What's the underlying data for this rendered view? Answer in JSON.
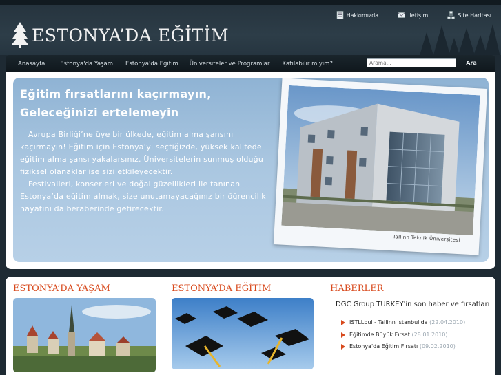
{
  "brand": {
    "title": "ESTONYA’DA EĞİTİM"
  },
  "toplinks": [
    {
      "label": "Hakkımızda",
      "icon": "document-icon"
    },
    {
      "label": "İletişim",
      "icon": "envelope-icon"
    },
    {
      "label": "Site Haritası",
      "icon": "sitemap-icon"
    }
  ],
  "nav": {
    "items": [
      {
        "label": "Anasayfa"
      },
      {
        "label": "Estonya'da Yaşam"
      },
      {
        "label": "Estonya'da Eğitim"
      },
      {
        "label": "Üniversiteler ve Programlar"
      },
      {
        "label": "Katılabilir miyim?"
      }
    ],
    "search_placeholder": "Arama...",
    "search_button": "Ara"
  },
  "hero": {
    "title_line1": "Eğitim fırsatlarını kaçırmayın,",
    "title_line2": "Geleceğinizi ertelemeyin",
    "para1": "Avrupa Birliği’ne üye bir ülkede, eğitim alma şansını kaçırmayın! Eğitim için Estonya’yı seçtiğizde, yüksek kalitede eğitim alma şansı yakalarsınız.  Üniversitelerin sunmuş olduğu fiziksel olanaklar ise sizi etkileyecektir.",
    "para2": "Festivalleri, konserleri ve doğal güzellikleri ile tanınan Estonya’da eğitim almak, size unutamayacağınız bir öğrencilik hayatını da beraberinde getirecektir.",
    "photo_caption": "Tallinn  Teknik  Üniversitesi"
  },
  "sections": {
    "yasam_title": "ESTONYA’DA YAŞAM",
    "egitim_title": "ESTONYA’DA EĞİTİM",
    "haberler_title": "HABERLER"
  },
  "news": {
    "heading": "DGC Group TURKEY'in son haber ve fırsatları",
    "items": [
      {
        "title": "ISTLLbul - Tallinn İstanbul'da",
        "date": "(22.04.2010)"
      },
      {
        "title": "Eğitimde Büyük Fırsat",
        "date": "(28.01.2010)"
      },
      {
        "title": "Estonya'da Eğitim Fırsatı",
        "date": "(09.02.2010)"
      }
    ]
  },
  "colors": {
    "accent": "#d84a1d",
    "header_bg": "#2d3d48",
    "hero_bg": "#a9c6e0"
  }
}
